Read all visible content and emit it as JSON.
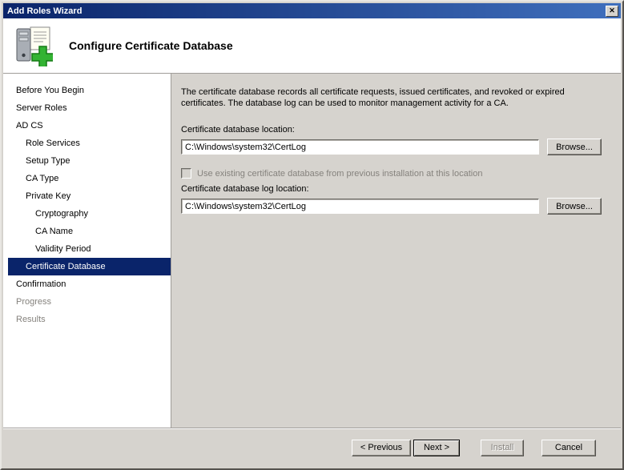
{
  "window": {
    "title": "Add Roles Wizard",
    "close_glyph": "✕"
  },
  "header": {
    "title": "Configure Certificate Database",
    "icon": "server-with-green-plus-icon"
  },
  "sidebar": {
    "items": [
      {
        "label": "Before You Begin",
        "indent": 0,
        "state": "normal"
      },
      {
        "label": "Server Roles",
        "indent": 0,
        "state": "normal"
      },
      {
        "label": "AD CS",
        "indent": 0,
        "state": "normal"
      },
      {
        "label": "Role Services",
        "indent": 1,
        "state": "normal"
      },
      {
        "label": "Setup Type",
        "indent": 1,
        "state": "normal"
      },
      {
        "label": "CA Type",
        "indent": 1,
        "state": "normal"
      },
      {
        "label": "Private Key",
        "indent": 1,
        "state": "normal"
      },
      {
        "label": "Cryptography",
        "indent": 2,
        "state": "normal"
      },
      {
        "label": "CA Name",
        "indent": 2,
        "state": "normal"
      },
      {
        "label": "Validity Period",
        "indent": 2,
        "state": "normal"
      },
      {
        "label": "Certificate Database",
        "indent": 1,
        "state": "selected"
      },
      {
        "label": "Confirmation",
        "indent": 0,
        "state": "normal"
      },
      {
        "label": "Progress",
        "indent": 0,
        "state": "disabled"
      },
      {
        "label": "Results",
        "indent": 0,
        "state": "disabled"
      }
    ]
  },
  "content": {
    "description": "The certificate database records all certificate requests, issued certificates, and revoked or expired certificates. The database log can be used to monitor management activity for a CA.",
    "db_location_label": "Certificate database location:",
    "db_location_value": "C:\\Windows\\system32\\CertLog",
    "browse_label": "Browse...",
    "checkbox_label": "Use existing certificate database from previous installation at this location",
    "checkbox_checked": false,
    "checkbox_enabled": false,
    "log_location_label": "Certificate database log location:",
    "log_location_value": "C:\\Windows\\system32\\CertLog",
    "browse2_label": "Browse..."
  },
  "footer": {
    "previous_label": "< Previous",
    "next_label": "Next >",
    "install_label": "Install",
    "cancel_label": "Cancel"
  },
  "colors": {
    "titlebar_start": "#0a246a",
    "titlebar_end": "#3f6fbd",
    "dialog_face": "#d6d3ce",
    "selected_step_bg": "#0a246a",
    "disabled_text": "#85827d"
  }
}
